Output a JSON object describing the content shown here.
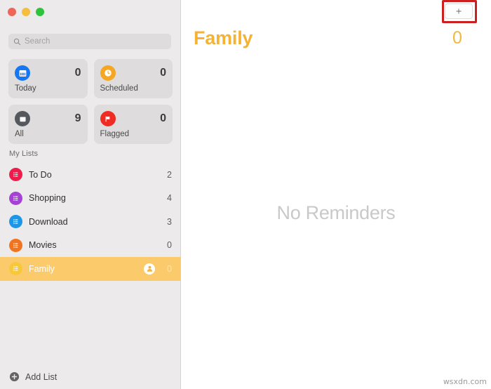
{
  "window": {
    "traffic_lights": [
      {
        "name": "close",
        "color": "#F0655A"
      },
      {
        "name": "minimize",
        "color": "#F6BE3F"
      },
      {
        "name": "maximize",
        "color": "#2FC23B"
      }
    ]
  },
  "sidebar": {
    "search": {
      "icon": "search-icon",
      "value": "",
      "placeholder": "Search"
    },
    "smart_tiles": [
      {
        "label": "Today",
        "count": "0",
        "icon": "calendar-icon",
        "color": "#1578F2"
      },
      {
        "label": "Scheduled",
        "count": "0",
        "icon": "clock-icon",
        "color": "#F5A623"
      },
      {
        "label": "All",
        "count": "9",
        "icon": "inbox-icon",
        "color": "#55595E"
      },
      {
        "label": "Flagged",
        "count": "0",
        "icon": "flag-icon",
        "color": "#F02B23"
      }
    ],
    "section_title": "My Lists",
    "lists": [
      {
        "name": "To Do",
        "count": "2",
        "color": "#EE1C4B",
        "shared": false,
        "selected": false
      },
      {
        "name": "Shopping",
        "count": "4",
        "color": "#A641D6",
        "shared": false,
        "selected": false
      },
      {
        "name": "Download",
        "count": "3",
        "color": "#1C96E8",
        "shared": false,
        "selected": false
      },
      {
        "name": "Movies",
        "count": "0",
        "color": "#F07420",
        "shared": false,
        "selected": false
      },
      {
        "name": "Family",
        "count": "0",
        "color": "#F8C83C",
        "shared": true,
        "selected": true
      }
    ],
    "add_list": {
      "label": "Add List",
      "icon": "plus-circle-icon"
    }
  },
  "main": {
    "add_reminder_button": {
      "icon": "plus-icon",
      "label": "+"
    },
    "title": "Family",
    "count": "0",
    "empty_state": "No Reminders",
    "accent_color": "#F5B335"
  },
  "watermark": "wsxdn.com"
}
